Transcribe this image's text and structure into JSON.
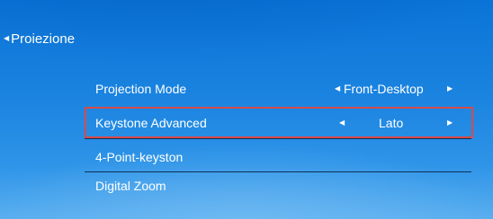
{
  "header": {
    "back_icon": "left-triangle-icon",
    "title": "Proiezione"
  },
  "menu": {
    "items": [
      {
        "label": "Projection Mode",
        "value": "Front-Desktop"
      },
      {
        "label": "Keystone Advanced",
        "value": "Lato",
        "selected": true
      },
      {
        "label": "4-Point-keyston"
      },
      {
        "label": "Digital Zoom"
      }
    ]
  },
  "colors": {
    "selection_border": "#d84a4a",
    "background_top": "#0a74d8",
    "background_bottom": "#58aeef",
    "text": "#ffffff"
  }
}
